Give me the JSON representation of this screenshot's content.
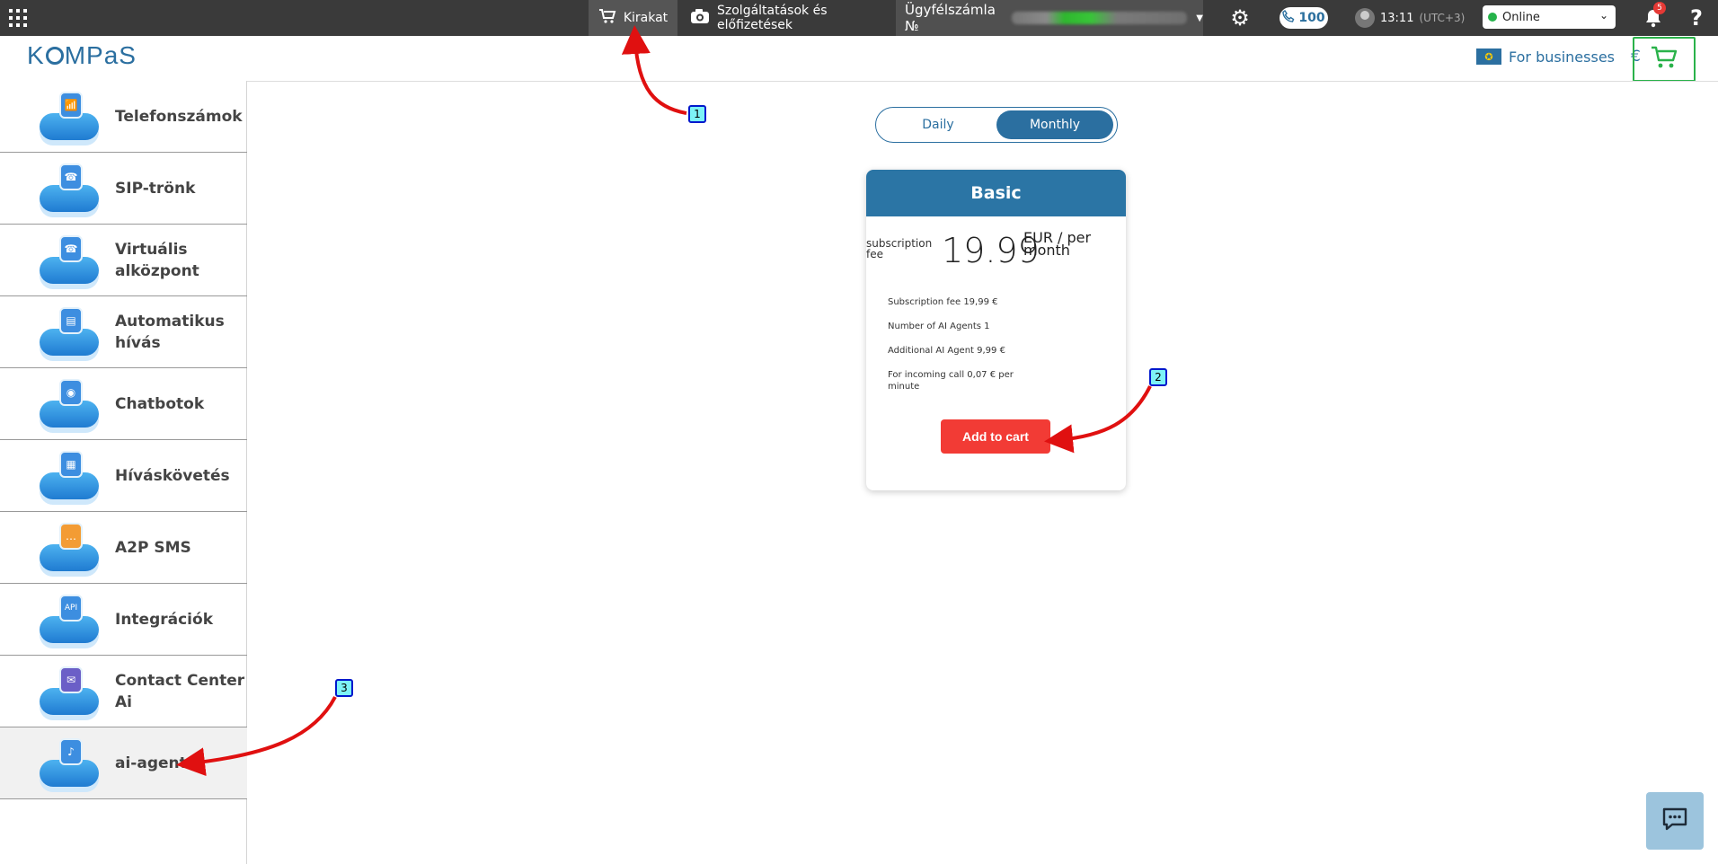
{
  "topbar": {
    "showcase_label": "Kirakat",
    "services_label": "Szolgáltatások és előfizetések",
    "account_label": "Ügyfélszámla №",
    "phone_count": "100",
    "time": "13:11",
    "timezone": "(UTC+3)",
    "status": "Online",
    "notifications_count": "5",
    "help": "?"
  },
  "header": {
    "logo_parts": [
      "K",
      "MP",
      "aS"
    ],
    "business_label": "For businesses",
    "currency": "€"
  },
  "sidebar": {
    "items": [
      {
        "label": "Telefonszámok",
        "icon": "📶"
      },
      {
        "label": "SIP-trönk",
        "icon": "☎"
      },
      {
        "label": "Virtuális alközpont",
        "icon": "☎"
      },
      {
        "label": "Automatikus hívás",
        "icon": "▤"
      },
      {
        "label": "Chatbotok",
        "icon": "◉"
      },
      {
        "label": "Híváskövetés",
        "icon": "▦"
      },
      {
        "label": "A2P SMS",
        "icon": "…"
      },
      {
        "label": "Integrációk",
        "icon": "API"
      },
      {
        "label": "Contact Center Ai",
        "icon": "✉"
      },
      {
        "label": "ai-agent",
        "icon": "♪"
      }
    ]
  },
  "pricing": {
    "toggle": {
      "daily": "Daily",
      "monthly": "Monthly",
      "selected": "Monthly"
    },
    "plan": {
      "name": "Basic",
      "fee_label": "subscription fee",
      "price": "19.99",
      "period": "EUR / per month",
      "features": [
        "Subscription fee 19,99 €",
        "Number of AI Agents 1",
        "Additional AI Agent 9,99 €",
        "For incoming call 0,07 € per minute"
      ],
      "button": "Add to cart"
    }
  },
  "annotations": [
    "1",
    "2",
    "3"
  ],
  "colors": {
    "brand": "#2b6fa0",
    "topbar": "#3a3a3a",
    "cta": "#f23b35",
    "online": "#25b34a",
    "cart": "#2ab24a"
  }
}
